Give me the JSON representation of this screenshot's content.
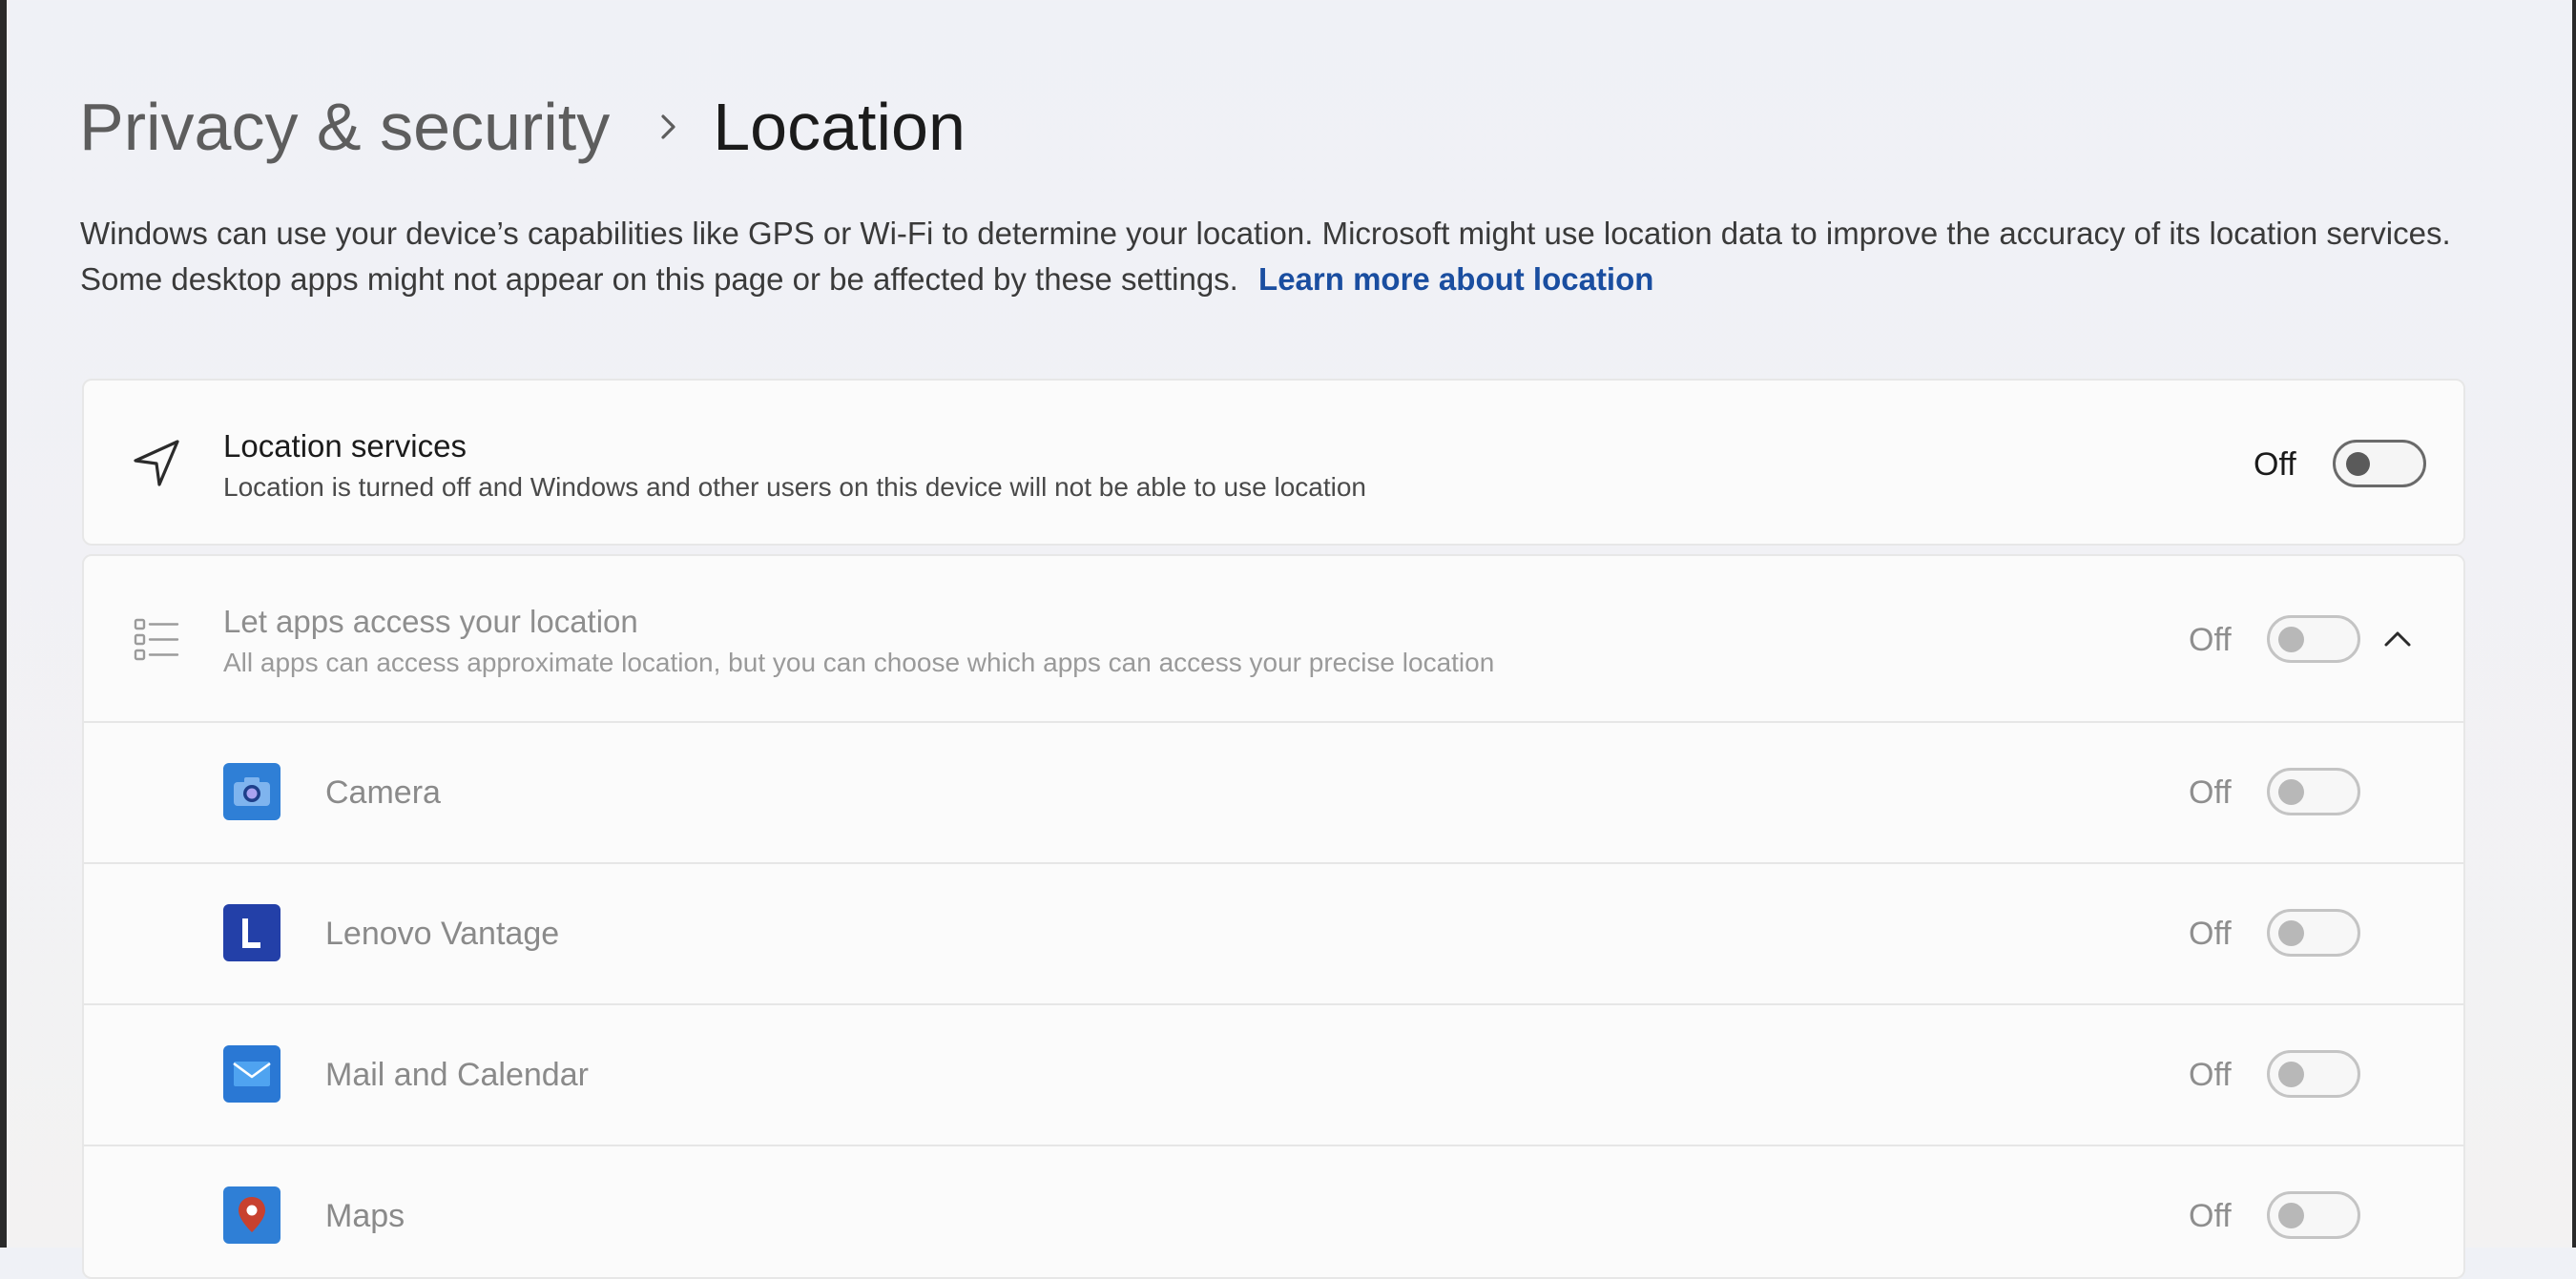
{
  "breadcrumb": {
    "parent": "Privacy & security",
    "current": "Location"
  },
  "description": {
    "text": "Windows can use your device’s capabilities like GPS or Wi-Fi to determine your location. Microsoft might use location data to improve the accuracy of its location services. Some desktop apps might not appear on this page or be affected by these settings.",
    "link": "Learn more about location"
  },
  "location_services": {
    "title": "Location services",
    "subtitle": "Location is turned off and Windows and other users on this device will not be able to use location",
    "state": "Off",
    "icon": "navigation-arrow-icon"
  },
  "app_access": {
    "title": "Let apps access your location",
    "subtitle": "All apps can access approximate location, but you can choose which apps can access your precise location",
    "state": "Off",
    "icon": "app-list-icon",
    "expand_icon": "chevron-up-icon"
  },
  "apps": [
    {
      "name": "Camera",
      "state": "Off",
      "icon": "camera-app-icon"
    },
    {
      "name": "Lenovo Vantage",
      "state": "Off",
      "icon": "lenovo-vantage-app-icon"
    },
    {
      "name": "Mail and Calendar",
      "state": "Off",
      "icon": "mail-app-icon"
    },
    {
      "name": "Maps",
      "state": "Off",
      "icon": "maps-app-icon"
    }
  ],
  "colors": {
    "link": "#1a4ea0",
    "lenovo_icon": "#2340a8",
    "app_icon_blue": "#2f7fd6",
    "maps_pin": "#c8412f"
  }
}
